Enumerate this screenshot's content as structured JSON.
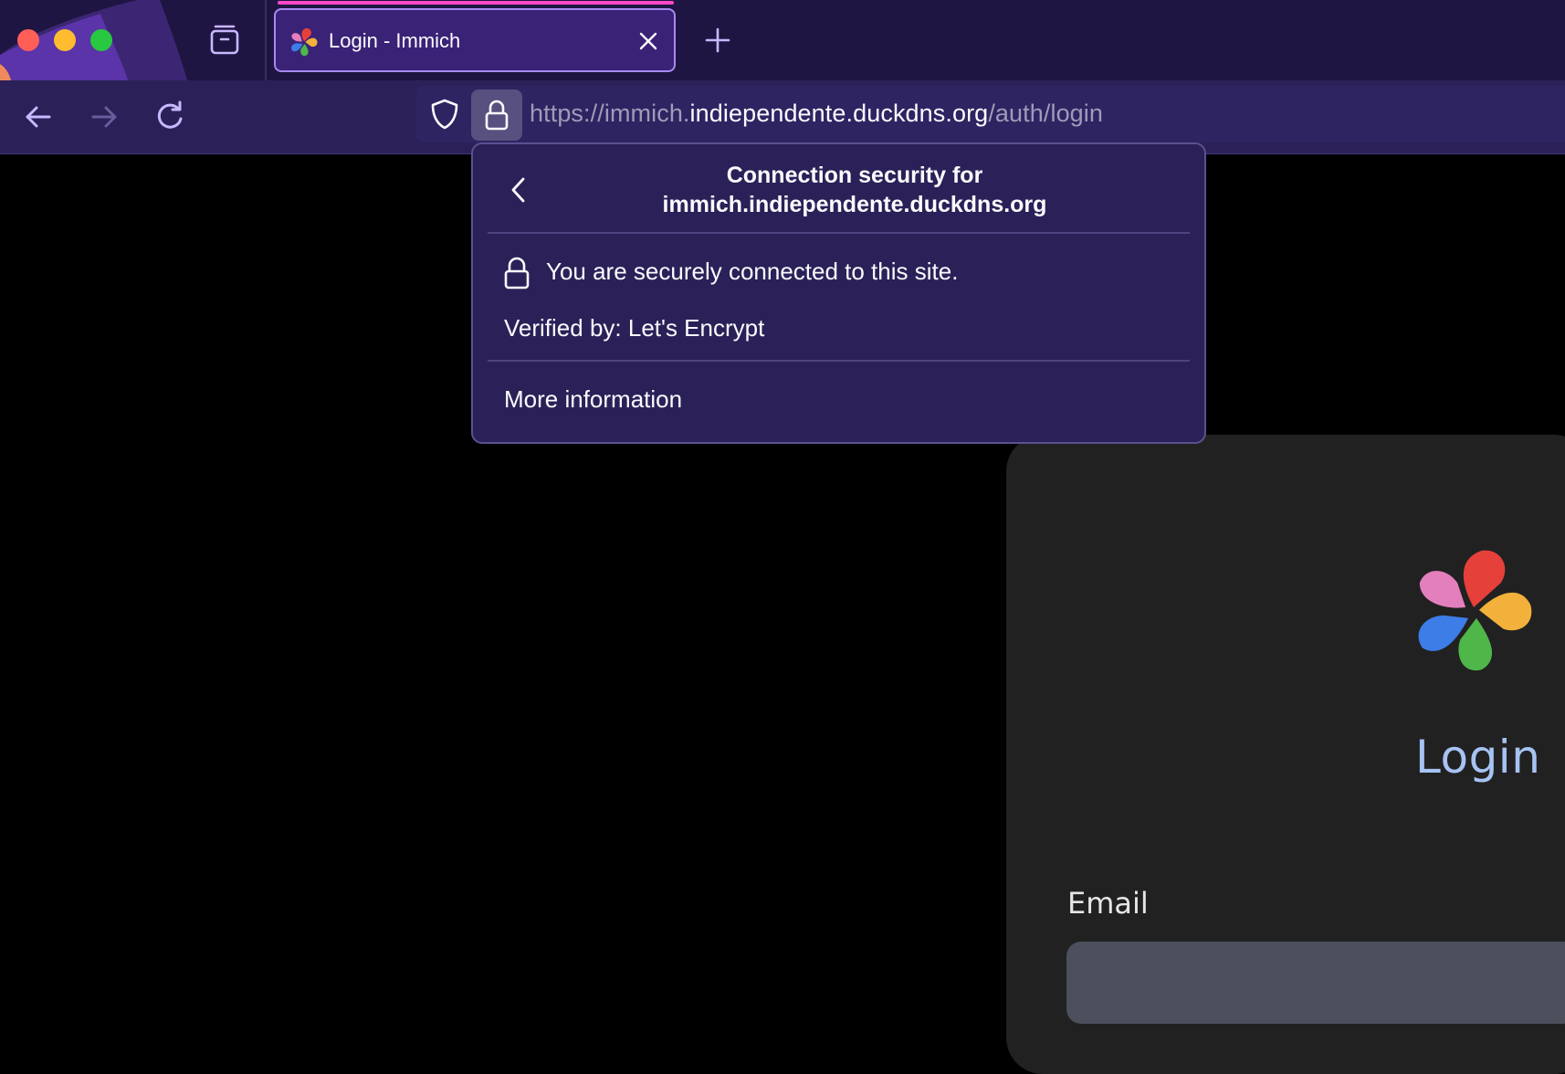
{
  "browser": {
    "tab": {
      "title": "Login - Immich"
    },
    "address_bar": {
      "url_prefix": "https://immich.",
      "url_host": "indiependente.duckdns.org",
      "url_path": "/auth/login"
    }
  },
  "security_popup": {
    "title_line1": "Connection security for",
    "title_line2": "immich.indiependente.duckdns.org",
    "secure_message": "You are securely connected to this site.",
    "verified_by": "Verified by: Let's Encrypt",
    "more_information": "More information"
  },
  "page": {
    "login_title": "Login",
    "email_label": "Email"
  },
  "colors": {
    "tab_strip": "#1f1542",
    "tab_accent": "#ff48c8",
    "popup_background": "#2b2158",
    "login_title": "#a6c3f3",
    "card_background": "#212121"
  },
  "icons": [
    "tabs-overview-icon",
    "immich-favicon-icon",
    "close-tab-icon",
    "new-tab-icon",
    "back-arrow-icon",
    "forward-arrow-icon",
    "reload-icon",
    "tracking-shield-icon",
    "lock-icon",
    "chevron-left-icon",
    "immich-logo-icon"
  ]
}
